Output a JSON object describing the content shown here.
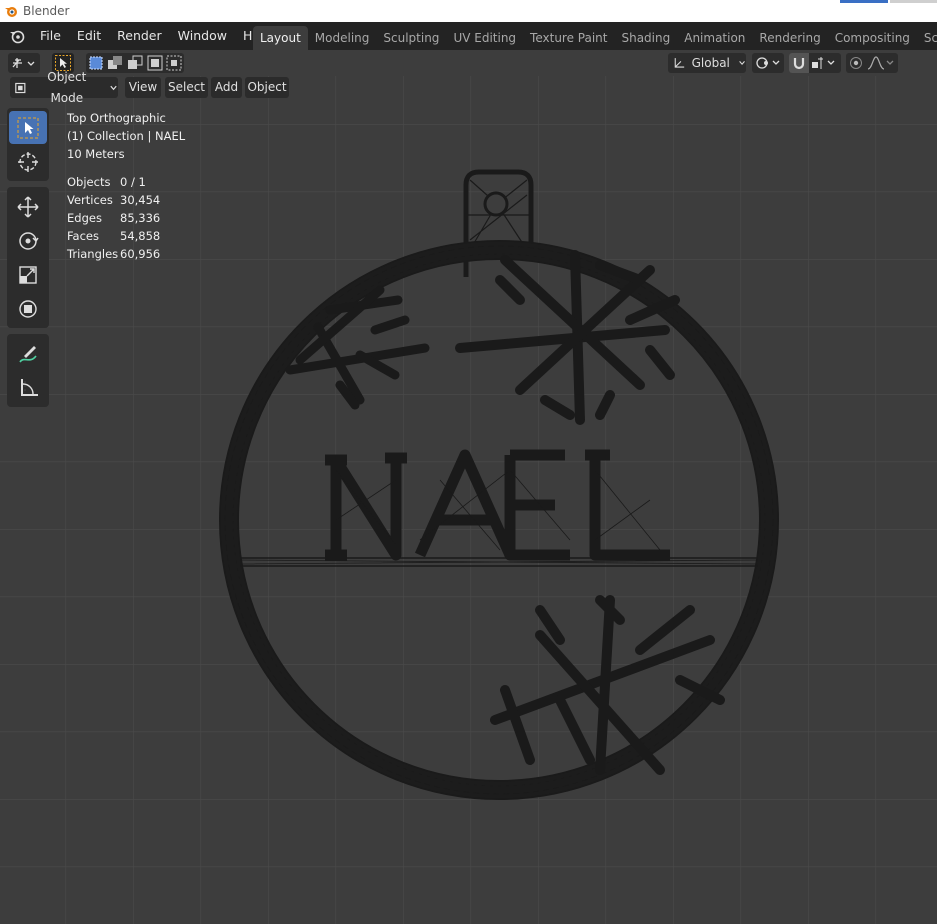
{
  "window": {
    "title": "Blender"
  },
  "menu": {
    "items": [
      "File",
      "Edit",
      "Render",
      "Window",
      "Help"
    ]
  },
  "tabs": [
    {
      "label": "Layout",
      "active": true
    },
    {
      "label": "Modeling",
      "active": false
    },
    {
      "label": "Sculpting",
      "active": false
    },
    {
      "label": "UV Editing",
      "active": false
    },
    {
      "label": "Texture Paint",
      "active": false
    },
    {
      "label": "Shading",
      "active": false
    },
    {
      "label": "Animation",
      "active": false
    },
    {
      "label": "Rendering",
      "active": false
    },
    {
      "label": "Compositing",
      "active": false
    },
    {
      "label": "Scripting",
      "active": false
    }
  ],
  "header": {
    "transform_orientation": "Global"
  },
  "viewport_header": {
    "mode": "Object Mode",
    "view": "View",
    "select": "Select",
    "add": "Add",
    "object": "Object"
  },
  "overlay": {
    "view_name": "Top Orthographic",
    "collection": "(1) Collection | NAEL",
    "scale": "10 Meters"
  },
  "stats": [
    {
      "label": "Objects",
      "value": "0 / 1"
    },
    {
      "label": "Vertices",
      "value": "30,454"
    },
    {
      "label": "Edges",
      "value": "85,336"
    },
    {
      "label": "Faces",
      "value": "54,858"
    },
    {
      "label": "Triangles",
      "value": "60,956"
    }
  ],
  "model": {
    "text": "NAEL"
  },
  "colors": {
    "accent": "#4772b3",
    "background": "#3d3d3d",
    "topbar": "#232323",
    "wire": "#1a1a1a"
  }
}
